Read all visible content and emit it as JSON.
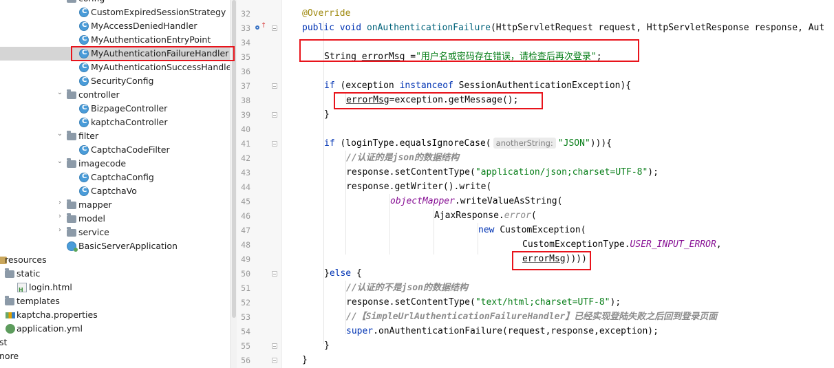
{
  "tree": {
    "items": [
      {
        "label": "config",
        "icon": "folder-icon",
        "kind": "folder",
        "expanded": true
      },
      {
        "label": "CustomExpiredSessionStrategy",
        "icon": "java-class-icon",
        "kind": "class"
      },
      {
        "label": "MyAccessDeniedHandler",
        "icon": "java-class-icon",
        "kind": "class"
      },
      {
        "label": "MyAuthenticationEntryPoint",
        "icon": "java-class-icon",
        "kind": "class"
      },
      {
        "label": "MyAuthenticationFailureHandler",
        "icon": "java-class-icon",
        "kind": "class",
        "selected": true
      },
      {
        "label": "MyAuthenticationSuccessHandler",
        "icon": "java-class-icon",
        "kind": "class"
      },
      {
        "label": "SecurityConfig",
        "icon": "java-class-icon",
        "kind": "class"
      },
      {
        "label": "controller",
        "icon": "folder-icon",
        "kind": "folder",
        "expanded": true
      },
      {
        "label": "BizpageController",
        "icon": "java-class-icon",
        "kind": "class"
      },
      {
        "label": "kaptchaController",
        "icon": "java-class-icon",
        "kind": "class"
      },
      {
        "label": "filter",
        "icon": "folder-icon",
        "kind": "folder",
        "expanded": true
      },
      {
        "label": "CaptchaCodeFilter",
        "icon": "java-class-icon",
        "kind": "class"
      },
      {
        "label": "imagecode",
        "icon": "folder-icon",
        "kind": "folder",
        "expanded": true
      },
      {
        "label": "CaptchaConfig",
        "icon": "java-class-icon",
        "kind": "class"
      },
      {
        "label": "CaptchaVo",
        "icon": "java-class-icon",
        "kind": "class"
      },
      {
        "label": "mapper",
        "icon": "folder-icon",
        "kind": "folder",
        "expanded": false
      },
      {
        "label": "model",
        "icon": "folder-icon",
        "kind": "folder",
        "expanded": false
      },
      {
        "label": "service",
        "icon": "folder-icon",
        "kind": "folder",
        "expanded": false
      },
      {
        "label": "BasicServerApplication",
        "icon": "spring-boot-app-icon",
        "kind": "app"
      },
      {
        "label": "resources",
        "icon": "resources-folder-icon",
        "kind": "resfolder"
      },
      {
        "label": "static",
        "icon": "folder-icon",
        "kind": "plainfolder"
      },
      {
        "label": "login.html",
        "icon": "html-file-icon",
        "kind": "html"
      },
      {
        "label": "templates",
        "icon": "folder-icon",
        "kind": "plainfolder"
      },
      {
        "label": "kaptcha.properties",
        "icon": "properties-file-icon",
        "kind": "props"
      },
      {
        "label": "application.yml",
        "icon": "yaml-file-icon",
        "kind": "yml"
      },
      {
        "label": "st",
        "icon": "",
        "kind": "text"
      },
      {
        "label": "nore",
        "icon": "",
        "kind": "text"
      }
    ]
  },
  "editor": {
    "lines": [
      {
        "no": "32",
        "tokens": [
          [
            "ann",
            "@Override"
          ]
        ]
      },
      {
        "no": "33",
        "tokens": [
          [
            "kw",
            "public "
          ],
          [
            "kw",
            "void "
          ],
          [
            "fn",
            "onAuthenticationFailure"
          ],
          [
            "",
            "(HttpServletRequest request, HttpServletResponse response, Aut"
          ]
        ]
      },
      {
        "no": "34",
        "tokens": []
      },
      {
        "no": "35",
        "tokens": [
          [
            "",
            "String "
          ],
          [
            "und",
            "errorMsg"
          ],
          [
            "",
            " ="
          ],
          [
            "str",
            "\"用户名或密码存在错误，请检查后再次登录\""
          ],
          [
            "",
            ";"
          ]
        ]
      },
      {
        "no": "36",
        "tokens": []
      },
      {
        "no": "37",
        "tokens": [
          [
            "kw",
            "if "
          ],
          [
            "",
            "(exception "
          ],
          [
            "kw",
            "instanceof "
          ],
          [
            "",
            "SessionAuthenticationException){"
          ]
        ]
      },
      {
        "no": "38",
        "tokens": [
          [
            "und",
            "errorMsg"
          ],
          [
            "",
            "=exception.getMessage();"
          ]
        ]
      },
      {
        "no": "39",
        "tokens": [
          [
            "",
            "}"
          ]
        ]
      },
      {
        "no": "40",
        "tokens": []
      },
      {
        "no": "41",
        "tokens": [
          [
            "kw",
            "if "
          ],
          [
            "",
            "(loginType.equalsIgnoreCase("
          ],
          [
            "hint",
            "anotherString:"
          ],
          [
            "str",
            "\"JSON\""
          ],
          [
            "",
            "))){"
          ]
        ]
      },
      {
        "no": "42",
        "tokens": [
          [
            "cmt-b",
            "//认证的是json的数据结构"
          ]
        ]
      },
      {
        "no": "43",
        "tokens": [
          [
            "",
            "response.setContentType("
          ],
          [
            "str",
            "\"application/json;charset=UTF-8\""
          ],
          [
            "",
            ");"
          ]
        ]
      },
      {
        "no": "44",
        "tokens": [
          [
            "",
            "response.getWriter().write("
          ]
        ]
      },
      {
        "no": "45",
        "tokens": [
          [
            "fld",
            "objectMapper"
          ],
          [
            "",
            ".writeValueAsString("
          ]
        ]
      },
      {
        "no": "46",
        "tokens": [
          [
            "",
            "AjaxResponse."
          ],
          [
            "cmt",
            "error"
          ],
          [
            "",
            "("
          ]
        ]
      },
      {
        "no": "47",
        "tokens": [
          [
            "kw",
            "new "
          ],
          [
            "",
            "CustomException("
          ]
        ]
      },
      {
        "no": "48",
        "tokens": [
          [
            "",
            "CustomExceptionType."
          ],
          [
            "fld",
            "USER_INPUT_ERROR"
          ],
          [
            "",
            ","
          ]
        ]
      },
      {
        "no": "49",
        "tokens": [
          [
            "und",
            "errorMsg"
          ],
          [
            "",
            "))))"
          ]
        ]
      },
      {
        "no": "50",
        "tokens": [
          [
            "",
            "}"
          ],
          [
            "kw",
            "else "
          ],
          [
            "",
            "{"
          ]
        ]
      },
      {
        "no": "51",
        "tokens": [
          [
            "cmt-b",
            "//认证的不是json的数据结构"
          ]
        ]
      },
      {
        "no": "52",
        "tokens": [
          [
            "",
            "response.setContentType("
          ],
          [
            "str",
            "\"text/html;charset=UTF-8\""
          ],
          [
            "",
            ");"
          ]
        ]
      },
      {
        "no": "53",
        "tokens": [
          [
            "cmt-b",
            "//【SimpleUrlAuthenticationFailureHandler】已经实现登陆失败之后回到登录页面"
          ]
        ]
      },
      {
        "no": "54",
        "tokens": [
          [
            "kw",
            "super"
          ],
          [
            "",
            ".onAuthenticationFailure(request,response,exception);"
          ]
        ]
      },
      {
        "no": "55",
        "tokens": [
          [
            "",
            "}"
          ]
        ]
      },
      {
        "no": "56",
        "tokens": [
          [
            "",
            "}"
          ]
        ]
      }
    ]
  },
  "colors": {
    "highlight_box": "#e8131b",
    "selection": "#d5d5d5"
  }
}
